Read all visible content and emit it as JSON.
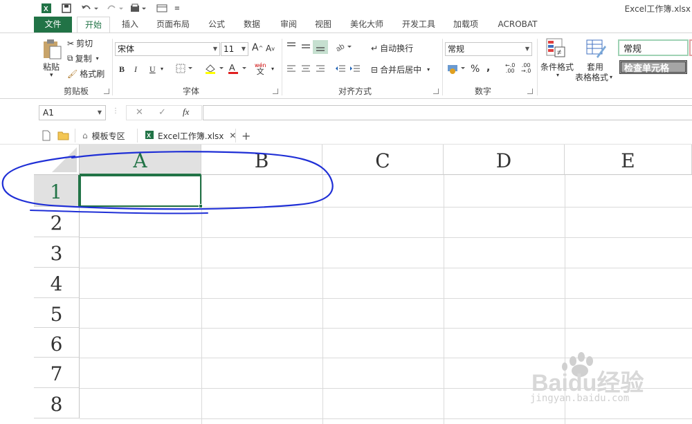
{
  "window": {
    "title": "Excel工作簿.xlsx"
  },
  "ribbon_tabs": [
    "文件",
    "开始",
    "插入",
    "页面布局",
    "公式",
    "数据",
    "审阅",
    "视图",
    "美化大师",
    "开发工具",
    "加载项",
    "ACROBAT"
  ],
  "active_tab": "开始",
  "clipboard": {
    "paste": "粘贴",
    "cut": "剪切",
    "copy": "复制",
    "format_painter": "格式刷",
    "label": "剪贴板"
  },
  "font": {
    "name": "宋体",
    "size": "11",
    "bold": "B",
    "italic": "I",
    "underline": "U",
    "wen": "wén",
    "wen_char": "文",
    "label": "字体"
  },
  "alignment": {
    "wrap_text": "自动换行",
    "merge_center": "合并后居中",
    "label": "对齐方式"
  },
  "number": {
    "format": "常规",
    "percent": "%",
    "comma": ",",
    "inc_dec": ".00",
    "inc_dec_small": "←.0",
    "dec_dec": ".00",
    "dec_dec_small": "→.0",
    "label": "数字"
  },
  "styles": {
    "conditional_format": "条件格式",
    "table_format_line1": "套用",
    "table_format_line2": "表格格式",
    "style_normal": "常规",
    "style_check_cell": "检查单元格"
  },
  "formula_bar": {
    "name_box": "A1",
    "fx": "fx",
    "formula": ""
  },
  "doc_tabs": {
    "template_zone": "模板专区",
    "workbook": "Excel工作簿.xlsx"
  },
  "grid": {
    "columns": [
      "A",
      "B",
      "C",
      "D",
      "E"
    ],
    "rows": [
      "1",
      "2",
      "3",
      "4",
      "5",
      "6",
      "7",
      "8"
    ],
    "selected_cell": "A1"
  },
  "watermark": {
    "brand": "Baidu经验",
    "url": "jingyan.baidu.com"
  },
  "colors": {
    "excel_green": "#217346",
    "annotation_blue": "#1f2fd6"
  }
}
